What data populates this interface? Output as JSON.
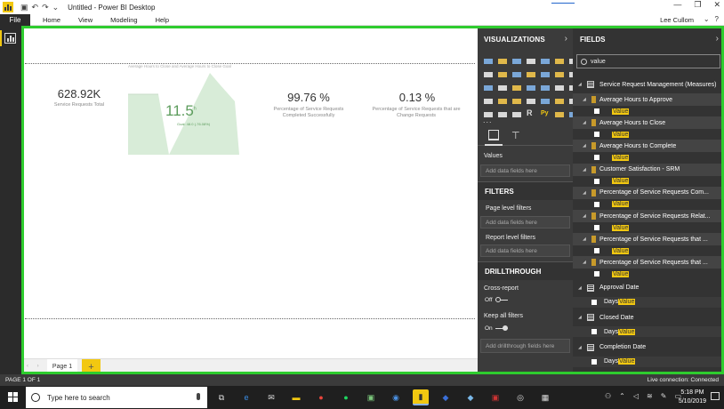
{
  "window": {
    "title": "Untitled - Power BI Desktop",
    "user": "Lee Cullom",
    "controls": [
      "—",
      "❐",
      "✕"
    ]
  },
  "ribbon": {
    "file_label": "File",
    "tabs": [
      "Home",
      "View",
      "Modeling",
      "Help"
    ]
  },
  "canvas": {
    "card1": {
      "value": "628.92K",
      "label": "Service Requests Total"
    },
    "gauge": {
      "title": "Average Hours to Close and Average Hours to Close Goal",
      "value": "11.5",
      "unit": "h",
      "goal": "Goal: 48.0 (-76.08%)"
    },
    "card2": {
      "value": "99.76 %",
      "label": "Percentage of Service Requests Completed Successfully"
    },
    "card3": {
      "value": "0.13 %",
      "label": "Percentage of Service Requests that are Change Requests"
    }
  },
  "pages": {
    "tabs": [
      "Page 1"
    ],
    "add_label": "+",
    "nav_arrows": "‹ ›"
  },
  "visualizations": {
    "header": "VISUALIZATIONS",
    "chevron": "›",
    "more": "...",
    "values_label": "Values",
    "values_placeholder": "Add data fields here",
    "filters_header": "FILTERS",
    "page_filters_label": "Page level filters",
    "page_filters_placeholder": "Add data fields here",
    "report_filters_label": "Report level filters",
    "report_filters_placeholder": "Add data fields here",
    "drillthrough_header": "DRILLTHROUGH",
    "cross_report_label": "Cross-report",
    "cross_report_state": "Off",
    "keep_filters_label": "Keep all filters",
    "keep_filters_state": "On",
    "drillthrough_placeholder": "Add drillthrough fields here",
    "icon_colors": [
      "#7aa7d8",
      "#e0b84a",
      "#7aa7d8",
      "#d8d8d8",
      "#7aa7d8",
      "#e0b84a",
      "#d8d8d8",
      "#d8d8d8",
      "#e0b84a",
      "#7aa7d8",
      "#e0b84a",
      "#7aa7d8",
      "#e0b84a",
      "#d8d8d8",
      "#7aa7d8",
      "#d8d8d8",
      "#e0b84a",
      "#7aa7d8",
      "#7aa7d8",
      "#d8d8d8",
      "#d8d8d8",
      "#d8d8d8",
      "#e0b84a",
      "#e0b84a",
      "#d8d8d8",
      "#7aa7d8",
      "#e0b84a",
      "#d8d8d8",
      "#d8d8d8",
      "#d8d8d8",
      "#d8d8d8",
      "#7aa7d8",
      "#7aa7d8",
      "#e0b84a",
      "#7aa7d8"
    ],
    "r_label": "R",
    "py_label": "Py"
  },
  "fields": {
    "header": "FIELDS",
    "chevron": "›",
    "search_value": "value",
    "table_name": "Service Request Management (Measures)",
    "measures": [
      {
        "name": "Average Hours to Approve",
        "sub": "Value"
      },
      {
        "name": "Average Hours to Close",
        "sub": "Value"
      },
      {
        "name": "Average Hours to Complete",
        "sub": "Value"
      },
      {
        "name": "Customer Satisfaction - SRM",
        "sub": "Value"
      },
      {
        "name": "Percentage of Service Requests Com...",
        "sub": "Value"
      },
      {
        "name": "Percentage of Service Requests Relat...",
        "sub": "Value"
      },
      {
        "name": "Percentage of Service Requests that ...",
        "sub": "Value"
      },
      {
        "name": "Percentage of Service Requests that ...",
        "sub": "Value"
      }
    ],
    "date_tables": [
      {
        "name": "Approval Date",
        "prefix": "Days",
        "sub": "Value"
      },
      {
        "name": "Closed Date",
        "prefix": "Days",
        "sub": "Value"
      },
      {
        "name": "Completion Date",
        "prefix": "Days",
        "sub": "Value"
      }
    ]
  },
  "status": {
    "page": "PAGE 1 OF 1",
    "connection": "Live connection: Connected"
  },
  "taskbar": {
    "search_placeholder": "Type here to search",
    "time": "5:18 PM",
    "date": "5/10/2019"
  }
}
